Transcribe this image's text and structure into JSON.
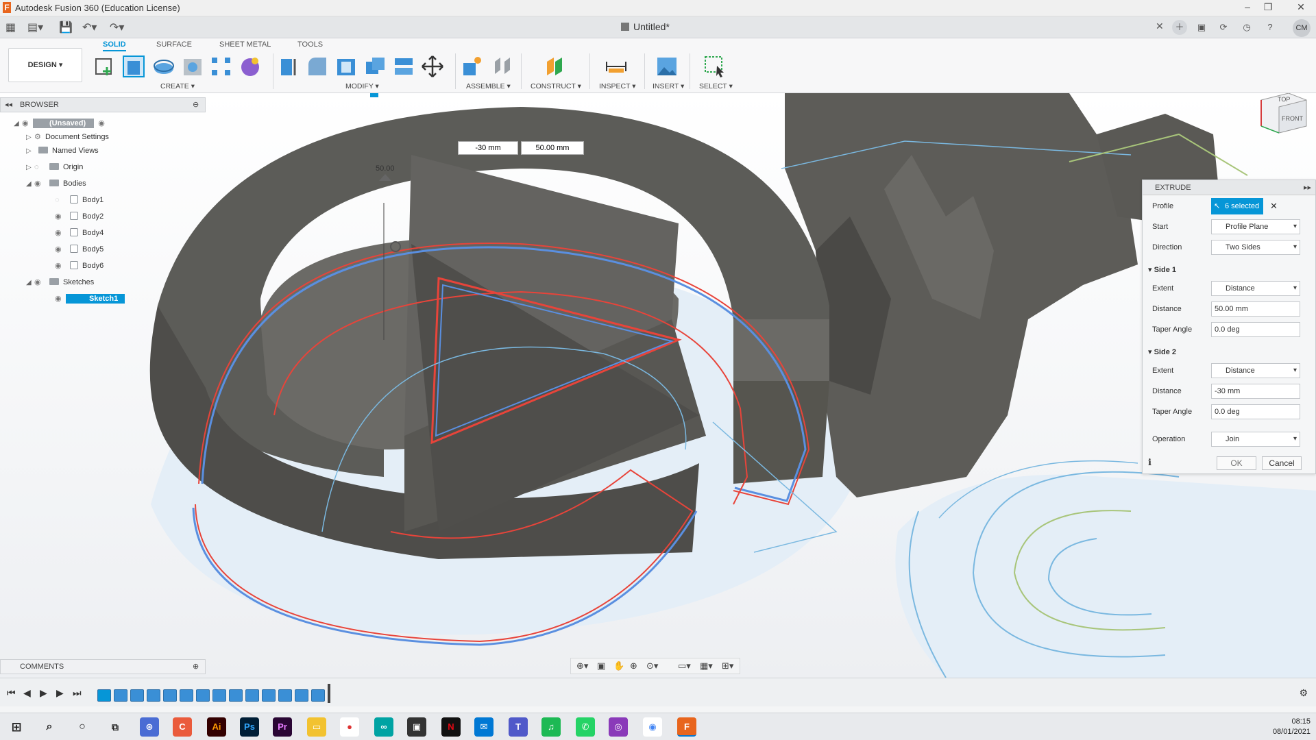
{
  "window": {
    "title": "Autodesk Fusion 360 (Education License)"
  },
  "doc": {
    "tab_title": "Untitled*"
  },
  "user": {
    "initials": "CM"
  },
  "workspace": {
    "mode_label": "DESIGN ▾"
  },
  "ribbon_tabs": [
    "SOLID",
    "SURFACE",
    "SHEET METAL",
    "TOOLS"
  ],
  "groups": {
    "create": "CREATE ▾",
    "modify": "MODIFY ▾",
    "assemble": "ASSEMBLE ▾",
    "construct": "CONSTRUCT ▾",
    "inspect": "INSPECT ▾",
    "insert": "INSERT ▾",
    "select": "SELECT ▾"
  },
  "browser": {
    "title": "BROWSER",
    "root": "(Unsaved)",
    "items": [
      "Document Settings",
      "Named Views",
      "Origin",
      "Bodies"
    ],
    "bodies": [
      "Body1",
      "Body2",
      "Body4",
      "Body5",
      "Body6"
    ],
    "sketches_label": "Sketches",
    "sketch": "Sketch1"
  },
  "comments": {
    "title": "COMMENTS"
  },
  "viewport": {
    "dim_left": "-30 mm",
    "dim_right": "50.00 mm",
    "dim_label": "50.00"
  },
  "viewcube": {
    "top": "TOP",
    "front": "FRONT"
  },
  "extrude": {
    "title": "EXTRUDE",
    "profile_label": "Profile",
    "profile_value": "6 selected",
    "start_label": "Start",
    "start_value": "Profile Plane",
    "direction_label": "Direction",
    "direction_value": "Two Sides",
    "side1_header": "Side 1",
    "side1_extent_label": "Extent",
    "side1_extent_value": "Distance",
    "side1_distance_label": "Distance",
    "side1_distance_value": "50.00 mm",
    "side1_taper_label": "Taper Angle",
    "side1_taper_value": "0.0 deg",
    "side2_header": "Side 2",
    "side2_extent_label": "Extent",
    "side2_extent_value": "Distance",
    "side2_distance_label": "Distance",
    "side2_distance_value": "-30 mm",
    "side2_taper_label": "Taper Angle",
    "side2_taper_value": "0.0 deg",
    "operation_label": "Operation",
    "operation_value": "Join",
    "ok": "OK",
    "cancel": "Cancel"
  },
  "taskbar": {
    "time": "08:15",
    "date": "08/01/2021"
  },
  "colors": {
    "accent": "#0696d7",
    "selection": "#3a8fd6",
    "body": "#5c5c58",
    "sketch_line": "#7ab8e0",
    "profile_red": "#e8443a"
  }
}
